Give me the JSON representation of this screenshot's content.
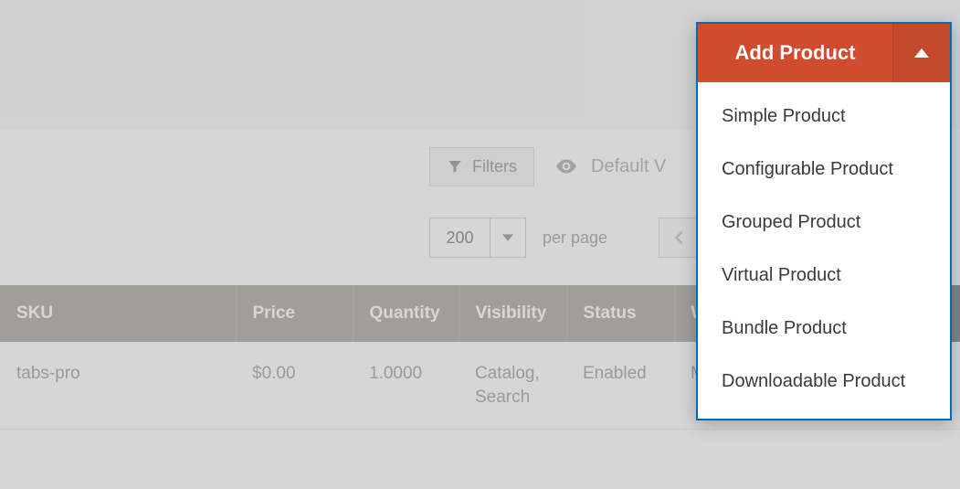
{
  "toolbar": {
    "filters_label": "Filters",
    "default_view_label": "Default V"
  },
  "pager": {
    "page_size": "200",
    "per_page_label": "per page"
  },
  "grid": {
    "headers": {
      "sku": "SKU",
      "price": "Price",
      "quantity": "Quantity",
      "visibility": "Visibility",
      "status": "Status",
      "websites": "We"
    },
    "rows": [
      {
        "sku": "tabs-pro",
        "price": "$0.00",
        "quantity": "1.0000",
        "visibility": "Catalog, Search",
        "status": "Enabled",
        "websites": "Mag"
      }
    ]
  },
  "add_product": {
    "label": "Add Product",
    "options": [
      "Simple Product",
      "Configurable Product",
      "Grouped Product",
      "Virtual Product",
      "Bundle Product",
      "Downloadable Product"
    ]
  }
}
